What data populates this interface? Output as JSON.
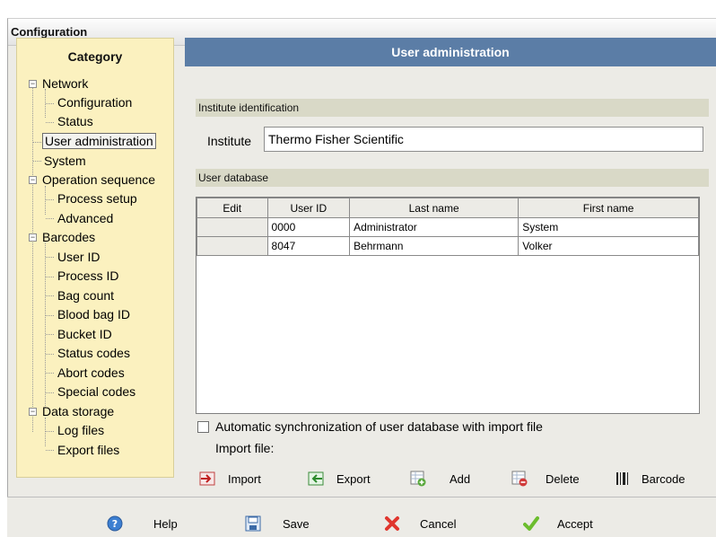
{
  "window": {
    "title": "Configuration"
  },
  "category": {
    "heading": "Category",
    "items": [
      {
        "label": "Network"
      },
      {
        "label": "Configuration"
      },
      {
        "label": "Status"
      },
      {
        "label": "User administration"
      },
      {
        "label": "System"
      },
      {
        "label": "Operation sequence"
      },
      {
        "label": "Process setup"
      },
      {
        "label": "Advanced"
      },
      {
        "label": "Barcodes"
      },
      {
        "label": "User ID"
      },
      {
        "label": "Process ID"
      },
      {
        "label": "Bag count"
      },
      {
        "label": "Blood bag ID"
      },
      {
        "label": "Bucket ID"
      },
      {
        "label": "Status codes"
      },
      {
        "label": "Abort codes"
      },
      {
        "label": "Special codes"
      },
      {
        "label": "Data storage"
      },
      {
        "label": "Log files"
      },
      {
        "label": "Export files"
      }
    ]
  },
  "main": {
    "heading": "User administration",
    "institute_section": "Institute identification",
    "institute_label": "Institute",
    "institute_value": "Thermo Fisher Scientific",
    "database_section": "User database",
    "columns": [
      "Edit",
      "User ID",
      "Last name",
      "First name"
    ],
    "rows": [
      {
        "edit": "",
        "user_id": "0000",
        "last_name": "Administrator",
        "first_name": "System"
      },
      {
        "edit": "",
        "user_id": "8047",
        "last_name": "Behrmann",
        "first_name": "Volker"
      }
    ],
    "sync_label": "Automatic synchronization of user database with import file",
    "sync_checked": false,
    "import_file_label": "Import file:"
  },
  "actions": {
    "import": "Import",
    "export": "Export",
    "add": "Add",
    "delete": "Delete",
    "barcode": "Barcode"
  },
  "footer": {
    "help": "Help",
    "save": "Save",
    "cancel": "Cancel",
    "accept": "Accept"
  },
  "colors": {
    "header_blue": "#5b7da6",
    "category_bg": "#fbf1bf",
    "section_bar": "#d9d9c7",
    "window_bg": "#ecebe6"
  }
}
